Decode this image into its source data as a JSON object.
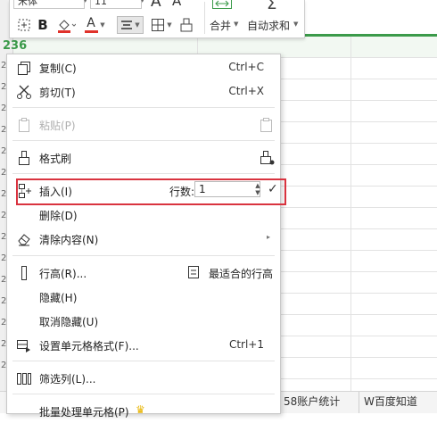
{
  "toolbar": {
    "font_name": "宋体",
    "font_size": "11",
    "bold": "B",
    "font_color_letter": "A",
    "grow_font": "A",
    "shrink_font": "A",
    "merge_label": "合并",
    "autosum_label": "自动求和",
    "accent_underline": "#e0322b"
  },
  "sheet": {
    "active_row": "236",
    "row_header_digit": "2",
    "accent_color": "#3b9a4a"
  },
  "menu": {
    "copy": {
      "label": "复制(C)",
      "shortcut": "Ctrl+C",
      "icon": "copy-icon"
    },
    "cut": {
      "label": "剪切(T)",
      "shortcut": "Ctrl+X",
      "icon": "scissors-icon"
    },
    "paste": {
      "label": "粘贴(P)",
      "icon": "paste-icon"
    },
    "format_painter": {
      "label": "格式刷",
      "icon": "brush-icon"
    },
    "insert": {
      "label": "插入(I)",
      "count_label": "行数:",
      "count_value": "1",
      "icon": "insert-row-icon"
    },
    "delete": {
      "label": "删除(D)"
    },
    "clear": {
      "label": "清除内容(N)",
      "icon": "eraser-icon"
    },
    "row_height": {
      "label": "行高(R)...",
      "icon": "row-height-icon"
    },
    "best_fit": {
      "label": "最适合的行高",
      "icon": "fit-row-icon"
    },
    "hide": {
      "label": "隐藏(H)"
    },
    "unhide": {
      "label": "取消隐藏(U)"
    },
    "format_cells": {
      "label": "设置单元格格式(F)...",
      "shortcut": "Ctrl+1",
      "icon": "format-cells-icon"
    },
    "filter_column": {
      "label": "筛选列(L)...",
      "icon": "filter-columns-icon"
    },
    "batch": {
      "label": "批量处理单元格(P)",
      "icon": "crown-icon"
    },
    "highlight_color": "#d9333f"
  },
  "tabs": [
    "58账户统计",
    "W百度知道"
  ]
}
